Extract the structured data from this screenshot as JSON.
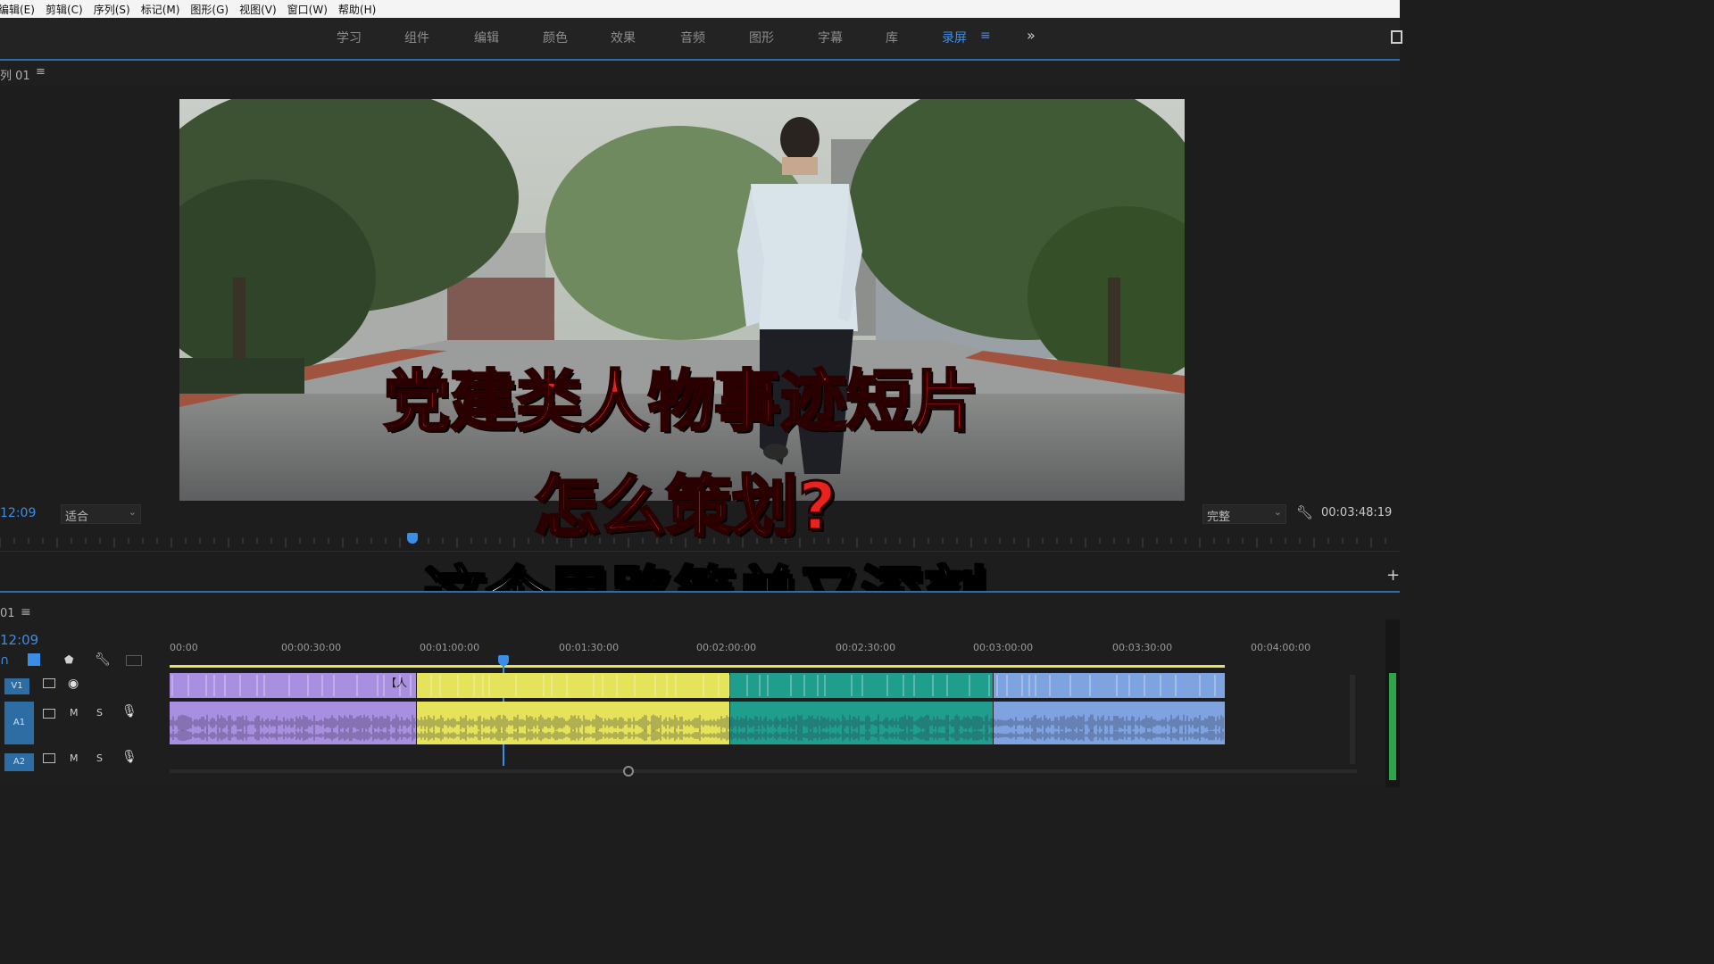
{
  "menu": [
    "编辑(E)",
    "剪辑(C)",
    "序列(S)",
    "标记(M)",
    "图形(G)",
    "视图(V)",
    "窗口(W)",
    "帮助(H)"
  ],
  "workspaces": [
    "学习",
    "组件",
    "编辑",
    "颜色",
    "效果",
    "音频",
    "图形",
    "字幕",
    "库",
    "录屏"
  ],
  "active_workspace": "录屏",
  "monitor": {
    "sequence_label": "列 01",
    "timecode_left": "12:09",
    "fit_label": "适合",
    "quality_label": "完整",
    "duration": "00:03:48:19"
  },
  "timeline": {
    "sequence_label": "01",
    "timecode": "12:09",
    "ruler_labels": [
      "00:00",
      "00:00:30:00",
      "00:01:00:00",
      "00:01:30:00",
      "00:02:00:00",
      "00:02:30:00",
      "00:03:00:00",
      "00:03:30:00",
      "00:04:00:00"
    ],
    "tracks": [
      {
        "id": "V1",
        "type": "video",
        "m": "",
        "s": ""
      },
      {
        "id": "A1",
        "type": "audio",
        "m": "M",
        "s": "S"
      },
      {
        "id": "A2",
        "type": "audio",
        "m": "M",
        "s": "S"
      }
    ],
    "clip_label": "【人"
  },
  "overlay": {
    "title_line1": "党建类人物事迹短片",
    "title_line2": "怎么策划?",
    "subtitle": "这个思路简单又深刻"
  },
  "colors": {
    "accent": "#3b8ee8",
    "clip_purple": "#a98fe0",
    "clip_yellow": "#e4e35a",
    "clip_teal": "#1f9e8e",
    "clip_blue": "#7ea3e0",
    "title_red": "#e8231b"
  },
  "icons": [
    "menu-icon",
    "chevron-right-double-icon",
    "wrench-icon",
    "eye-icon",
    "mic-icon",
    "track-toggle-icon",
    "marker-icon",
    "add-icon"
  ]
}
